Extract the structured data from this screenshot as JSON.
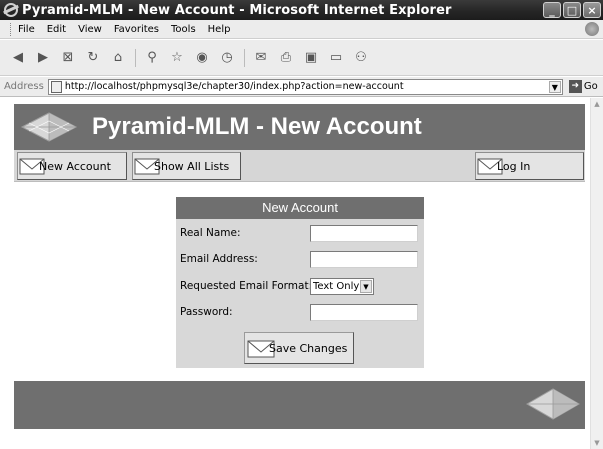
{
  "window": {
    "title": "Pyramid-MLM - New Account - Microsoft Internet Explorer",
    "min": "_",
    "max": "□",
    "close": "×"
  },
  "menu": [
    "File",
    "Edit",
    "View",
    "Favorites",
    "Tools",
    "Help"
  ],
  "toolbar_icons": [
    "back-icon",
    "forward-icon",
    "stop-icon",
    "refresh-icon",
    "home-icon",
    "search-icon",
    "favorites-icon",
    "media-icon",
    "history-icon",
    "mail-icon",
    "print-icon",
    "edit-icon",
    "discuss-icon",
    "messenger-icon"
  ],
  "address": {
    "label": "Address",
    "url": "http://localhost/phpmysql3e/chapter30/index.php?action=new-account",
    "go": "Go"
  },
  "page": {
    "header_title": "Pyramid-MLM - New Account",
    "nav": {
      "new_account": "New Account",
      "show_all_lists": "Show All Lists",
      "log_in": "Log In"
    },
    "form": {
      "heading": "New Account",
      "real_name_label": "Real Name:",
      "email_label": "Email Address:",
      "format_label": "Requested Email Format:",
      "format_value": "Text Only",
      "password_label": "Password:",
      "save_label": "Save Changes"
    }
  },
  "colors": {
    "band": "#6f6f6f",
    "nav_bg": "#d6d6d6",
    "form_bg": "#d8d8d8"
  }
}
